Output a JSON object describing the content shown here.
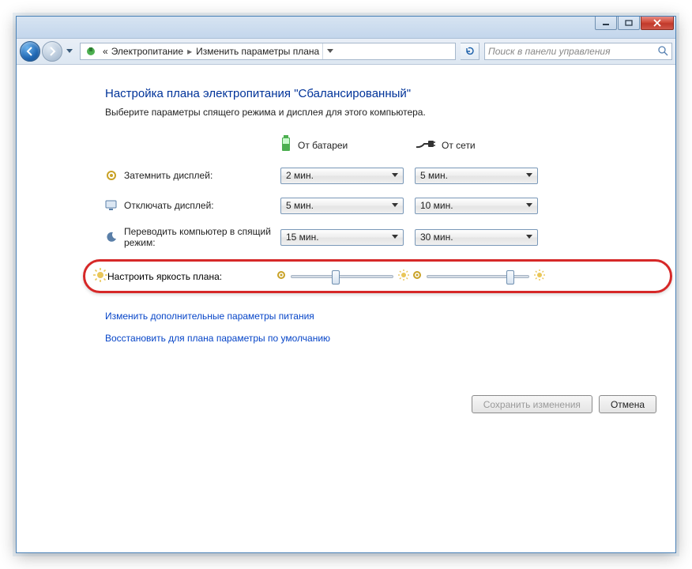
{
  "nav": {
    "breadcrumb_prefix": "«",
    "crumb1": "Электропитание",
    "crumb2": "Изменить параметры плана",
    "search_placeholder": "Поиск в панели управления"
  },
  "page": {
    "heading": "Настройка плана электропитания \"Сбалансированный\"",
    "subtext": "Выберите параметры спящего режима и дисплея для этого компьютера."
  },
  "columns": {
    "battery": "От батареи",
    "plugged": "От сети"
  },
  "rows": {
    "dim": {
      "label": "Затемнить дисплей:",
      "battery": "2 мин.",
      "plugged": "5 мин."
    },
    "display_off": {
      "label": "Отключать дисплей:",
      "battery": "5 мин.",
      "plugged": "10 мин."
    },
    "sleep": {
      "label": "Переводить компьютер в спящий режим:",
      "battery": "15 мин.",
      "plugged": "30 мин."
    },
    "brightness": {
      "label": "Настроить яркость плана:"
    }
  },
  "links": {
    "advanced": "Изменить дополнительные параметры питания",
    "restore": "Восстановить для плана параметры по умолчанию"
  },
  "buttons": {
    "save": "Сохранить изменения",
    "cancel": "Отмена"
  }
}
